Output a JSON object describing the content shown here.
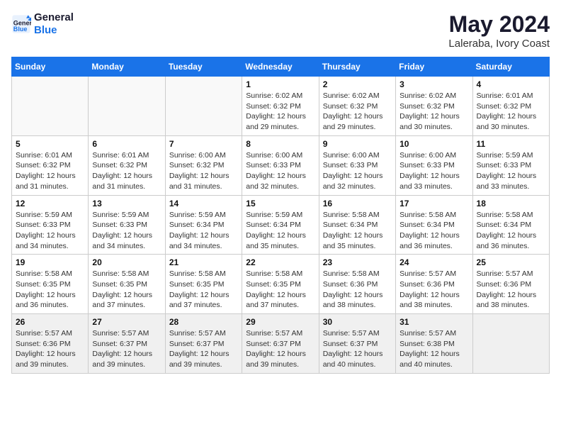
{
  "header": {
    "logo_line1": "General",
    "logo_line2": "Blue",
    "month_year": "May 2024",
    "location": "Laleraba, Ivory Coast"
  },
  "weekdays": [
    "Sunday",
    "Monday",
    "Tuesday",
    "Wednesday",
    "Thursday",
    "Friday",
    "Saturday"
  ],
  "weeks": [
    [
      {
        "day": "",
        "info": ""
      },
      {
        "day": "",
        "info": ""
      },
      {
        "day": "",
        "info": ""
      },
      {
        "day": "1",
        "info": "Sunrise: 6:02 AM\nSunset: 6:32 PM\nDaylight: 12 hours\nand 29 minutes."
      },
      {
        "day": "2",
        "info": "Sunrise: 6:02 AM\nSunset: 6:32 PM\nDaylight: 12 hours\nand 29 minutes."
      },
      {
        "day": "3",
        "info": "Sunrise: 6:02 AM\nSunset: 6:32 PM\nDaylight: 12 hours\nand 30 minutes."
      },
      {
        "day": "4",
        "info": "Sunrise: 6:01 AM\nSunset: 6:32 PM\nDaylight: 12 hours\nand 30 minutes."
      }
    ],
    [
      {
        "day": "5",
        "info": "Sunrise: 6:01 AM\nSunset: 6:32 PM\nDaylight: 12 hours\nand 31 minutes."
      },
      {
        "day": "6",
        "info": "Sunrise: 6:01 AM\nSunset: 6:32 PM\nDaylight: 12 hours\nand 31 minutes."
      },
      {
        "day": "7",
        "info": "Sunrise: 6:00 AM\nSunset: 6:32 PM\nDaylight: 12 hours\nand 31 minutes."
      },
      {
        "day": "8",
        "info": "Sunrise: 6:00 AM\nSunset: 6:33 PM\nDaylight: 12 hours\nand 32 minutes."
      },
      {
        "day": "9",
        "info": "Sunrise: 6:00 AM\nSunset: 6:33 PM\nDaylight: 12 hours\nand 32 minutes."
      },
      {
        "day": "10",
        "info": "Sunrise: 6:00 AM\nSunset: 6:33 PM\nDaylight: 12 hours\nand 33 minutes."
      },
      {
        "day": "11",
        "info": "Sunrise: 5:59 AM\nSunset: 6:33 PM\nDaylight: 12 hours\nand 33 minutes."
      }
    ],
    [
      {
        "day": "12",
        "info": "Sunrise: 5:59 AM\nSunset: 6:33 PM\nDaylight: 12 hours\nand 34 minutes."
      },
      {
        "day": "13",
        "info": "Sunrise: 5:59 AM\nSunset: 6:33 PM\nDaylight: 12 hours\nand 34 minutes."
      },
      {
        "day": "14",
        "info": "Sunrise: 5:59 AM\nSunset: 6:34 PM\nDaylight: 12 hours\nand 34 minutes."
      },
      {
        "day": "15",
        "info": "Sunrise: 5:59 AM\nSunset: 6:34 PM\nDaylight: 12 hours\nand 35 minutes."
      },
      {
        "day": "16",
        "info": "Sunrise: 5:58 AM\nSunset: 6:34 PM\nDaylight: 12 hours\nand 35 minutes."
      },
      {
        "day": "17",
        "info": "Sunrise: 5:58 AM\nSunset: 6:34 PM\nDaylight: 12 hours\nand 36 minutes."
      },
      {
        "day": "18",
        "info": "Sunrise: 5:58 AM\nSunset: 6:34 PM\nDaylight: 12 hours\nand 36 minutes."
      }
    ],
    [
      {
        "day": "19",
        "info": "Sunrise: 5:58 AM\nSunset: 6:35 PM\nDaylight: 12 hours\nand 36 minutes."
      },
      {
        "day": "20",
        "info": "Sunrise: 5:58 AM\nSunset: 6:35 PM\nDaylight: 12 hours\nand 37 minutes."
      },
      {
        "day": "21",
        "info": "Sunrise: 5:58 AM\nSunset: 6:35 PM\nDaylight: 12 hours\nand 37 minutes."
      },
      {
        "day": "22",
        "info": "Sunrise: 5:58 AM\nSunset: 6:35 PM\nDaylight: 12 hours\nand 37 minutes."
      },
      {
        "day": "23",
        "info": "Sunrise: 5:58 AM\nSunset: 6:36 PM\nDaylight: 12 hours\nand 38 minutes."
      },
      {
        "day": "24",
        "info": "Sunrise: 5:57 AM\nSunset: 6:36 PM\nDaylight: 12 hours\nand 38 minutes."
      },
      {
        "day": "25",
        "info": "Sunrise: 5:57 AM\nSunset: 6:36 PM\nDaylight: 12 hours\nand 38 minutes."
      }
    ],
    [
      {
        "day": "26",
        "info": "Sunrise: 5:57 AM\nSunset: 6:36 PM\nDaylight: 12 hours\nand 39 minutes."
      },
      {
        "day": "27",
        "info": "Sunrise: 5:57 AM\nSunset: 6:37 PM\nDaylight: 12 hours\nand 39 minutes."
      },
      {
        "day": "28",
        "info": "Sunrise: 5:57 AM\nSunset: 6:37 PM\nDaylight: 12 hours\nand 39 minutes."
      },
      {
        "day": "29",
        "info": "Sunrise: 5:57 AM\nSunset: 6:37 PM\nDaylight: 12 hours\nand 39 minutes."
      },
      {
        "day": "30",
        "info": "Sunrise: 5:57 AM\nSunset: 6:37 PM\nDaylight: 12 hours\nand 40 minutes."
      },
      {
        "day": "31",
        "info": "Sunrise: 5:57 AM\nSunset: 6:38 PM\nDaylight: 12 hours\nand 40 minutes."
      },
      {
        "day": "",
        "info": ""
      }
    ]
  ]
}
